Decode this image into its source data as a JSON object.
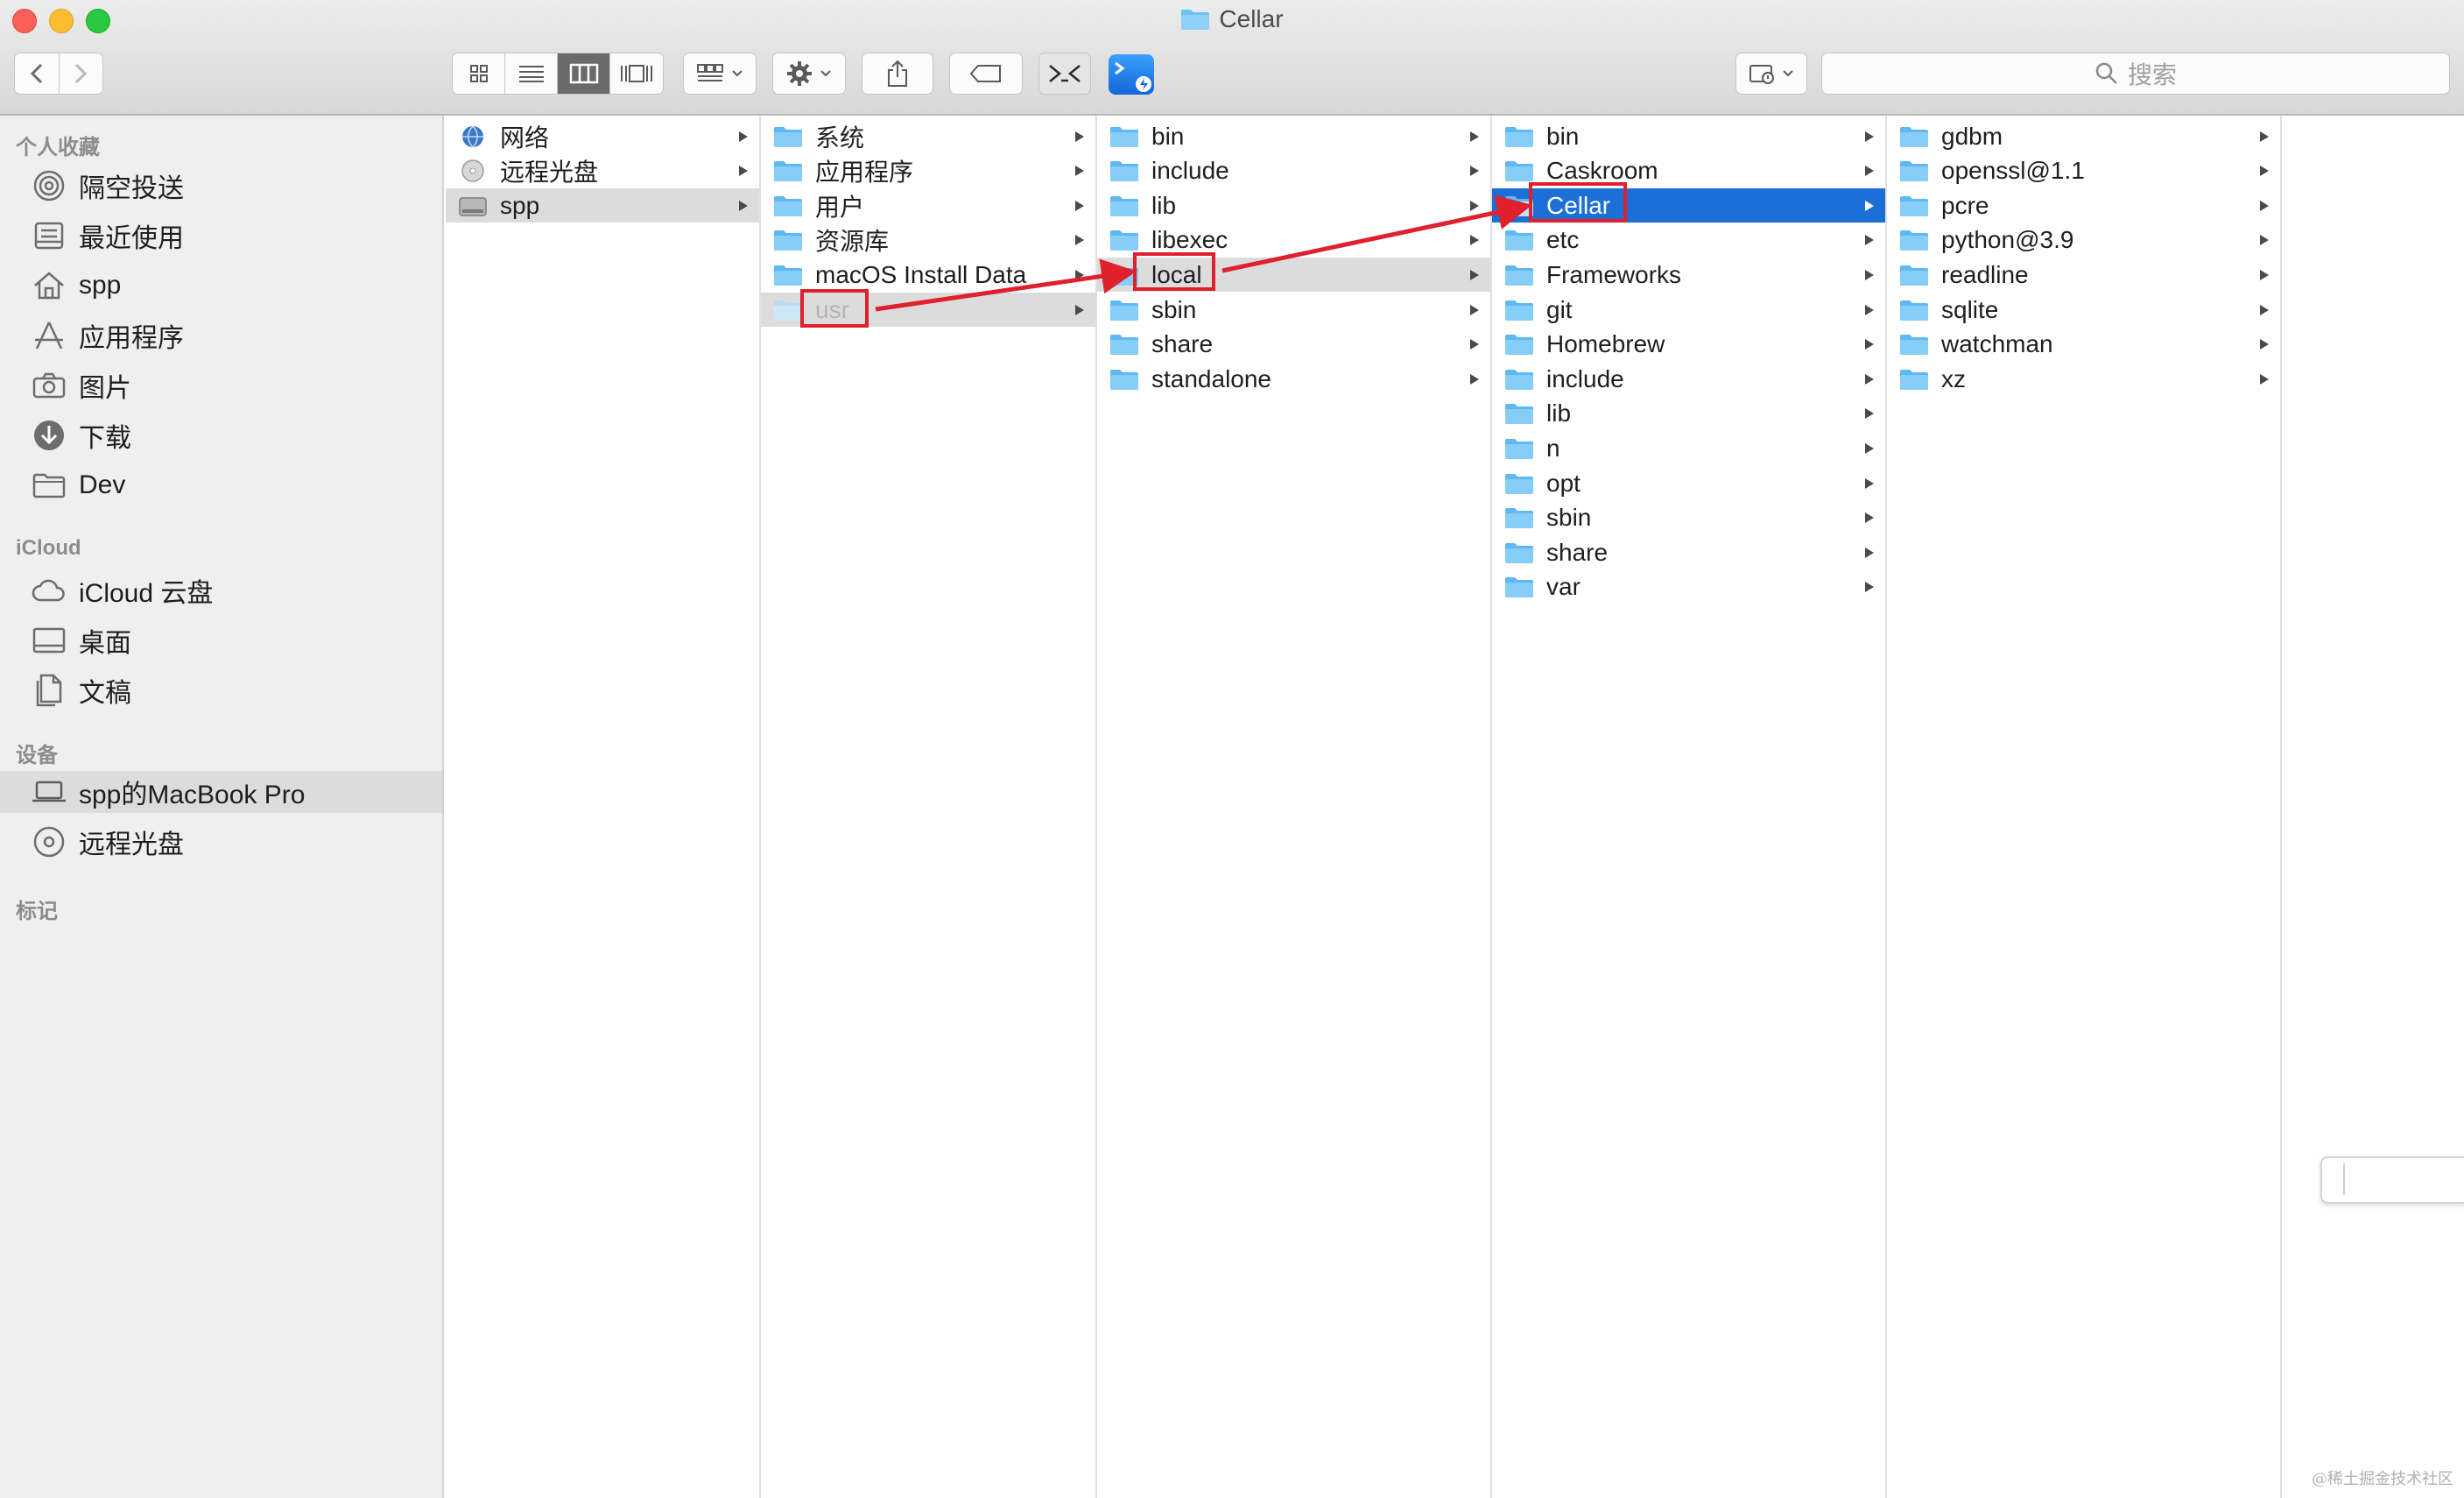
{
  "window": {
    "title": "Cellar"
  },
  "toolbar": {
    "search_placeholder": "搜索",
    "view_modes": [
      "icon",
      "list",
      "column",
      "gallery"
    ],
    "active_view": "column"
  },
  "sidebar": {
    "favorites_header": "个人收藏",
    "favorites": [
      {
        "label": "隔空投送",
        "icon": "airdrop-icon"
      },
      {
        "label": "最近使用",
        "icon": "recents-icon"
      },
      {
        "label": "spp",
        "icon": "home-icon"
      },
      {
        "label": "应用程序",
        "icon": "applications-icon"
      },
      {
        "label": "图片",
        "icon": "camera-icon"
      },
      {
        "label": "下载",
        "icon": "download-icon"
      },
      {
        "label": "Dev",
        "icon": "folder-icon"
      }
    ],
    "icloud_header": "iCloud",
    "icloud": [
      {
        "label": "iCloud 云盘",
        "icon": "cloud-icon"
      },
      {
        "label": "桌面",
        "icon": "desktop-icon"
      },
      {
        "label": "文稿",
        "icon": "document-icon"
      }
    ],
    "devices_header": "设备",
    "devices": [
      {
        "label": "spp的MacBook Pro",
        "icon": "laptop-icon",
        "selected": true
      },
      {
        "label": "远程光盘",
        "icon": "disc-icon"
      }
    ],
    "tags_header": "标记"
  },
  "columns": [
    {
      "items": [
        {
          "name": "网络",
          "icon": "network-globe-icon"
        },
        {
          "name": "远程光盘",
          "icon": "disc-icon"
        },
        {
          "name": "spp",
          "icon": "hard-drive-icon",
          "state": "path"
        }
      ]
    },
    {
      "items": [
        {
          "name": "系统",
          "icon": "folder-icon"
        },
        {
          "name": "应用程序",
          "icon": "folder-icon"
        },
        {
          "name": "用户",
          "icon": "folder-icon"
        },
        {
          "name": "资源库",
          "icon": "folder-icon"
        },
        {
          "name": "macOS Install Data",
          "icon": "folder-icon"
        },
        {
          "name": "usr",
          "icon": "folder-icon",
          "state": "path-hidden"
        }
      ]
    },
    {
      "items": [
        {
          "name": "bin"
        },
        {
          "name": "include"
        },
        {
          "name": "lib"
        },
        {
          "name": "libexec"
        },
        {
          "name": "local",
          "state": "path"
        },
        {
          "name": "sbin"
        },
        {
          "name": "share"
        },
        {
          "name": "standalone"
        }
      ]
    },
    {
      "items": [
        {
          "name": "bin"
        },
        {
          "name": "Caskroom"
        },
        {
          "name": "Cellar",
          "state": "selected"
        },
        {
          "name": "etc"
        },
        {
          "name": "Frameworks"
        },
        {
          "name": "git"
        },
        {
          "name": "Homebrew"
        },
        {
          "name": "include"
        },
        {
          "name": "lib"
        },
        {
          "name": "n"
        },
        {
          "name": "opt"
        },
        {
          "name": "sbin"
        },
        {
          "name": "share"
        },
        {
          "name": "var"
        }
      ]
    },
    {
      "items": [
        {
          "name": "gdbm"
        },
        {
          "name": "openssl@1.1"
        },
        {
          "name": "pcre"
        },
        {
          "name": "python@3.9"
        },
        {
          "name": "readline"
        },
        {
          "name": "sqlite"
        },
        {
          "name": "watchman"
        },
        {
          "name": "xz"
        }
      ]
    }
  ],
  "annotation_color": "#e0202c",
  "selection_color": "#1b6fd6",
  "watermark": "@稀土掘金技术社区"
}
